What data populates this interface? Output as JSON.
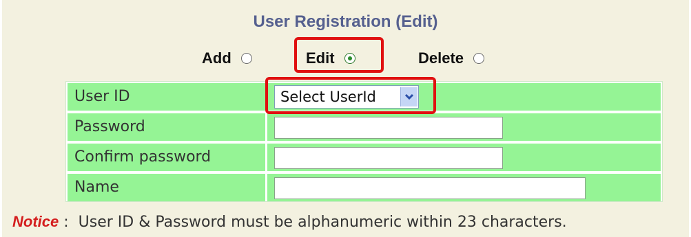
{
  "title": "User Registration (Edit)",
  "modes": [
    {
      "label": "Add",
      "checked": false
    },
    {
      "label": "Edit",
      "checked": true
    },
    {
      "label": "Delete",
      "checked": false
    }
  ],
  "form": {
    "user_id_label": "User ID",
    "user_id_select_value": "Select UserId",
    "password_label": "Password",
    "password_value": "",
    "confirm_password_label": "Confirm password",
    "confirm_password_value": "",
    "name_label": "Name",
    "name_value": ""
  },
  "notice": {
    "label": "Notice",
    "separator": " :  ",
    "text": "User ID & Password must be alphanumeric within 23 characters."
  },
  "colors": {
    "title": "#55608f",
    "row_green": "#95f495",
    "highlight_red": "#e01010",
    "notice_red": "#d41e1e",
    "panel_bg": "#f3f1e0"
  },
  "icons": {
    "select_arrow": "chevron-down-icon"
  }
}
